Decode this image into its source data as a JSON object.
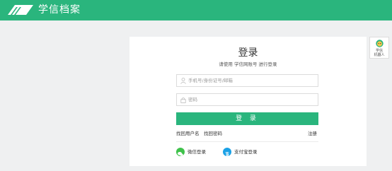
{
  "header": {
    "logo_icon": "book-logo-icon",
    "app_name": "学信档案",
    "bg_color": "#2ab57d"
  },
  "login": {
    "title": "登录",
    "subtitle": "请使用 学信网账号 进行登录",
    "username_placeholder": "手机号/身份证号/邮箱",
    "username_value": "",
    "username_icon": "user-icon",
    "password_placeholder": "密码",
    "password_value": "",
    "password_icon": "lock-icon",
    "submit_label": "登 录",
    "links": {
      "find_username": "找回用户名",
      "find_password": "找回密码",
      "register": "注册"
    },
    "social": {
      "wechat_label": "微信登录",
      "wechat_icon": "wechat-icon",
      "alipay_label": "支付宝登录",
      "alipay_icon": "alipay-icon"
    }
  },
  "robot": {
    "icon": "robot-icon",
    "label_line1": "学信",
    "label_line2": "机器人"
  },
  "colors": {
    "accent": "#2ab57d",
    "page_bg": "#eff0f1",
    "wechat": "#3fc24b",
    "alipay": "#1aa1e6"
  }
}
